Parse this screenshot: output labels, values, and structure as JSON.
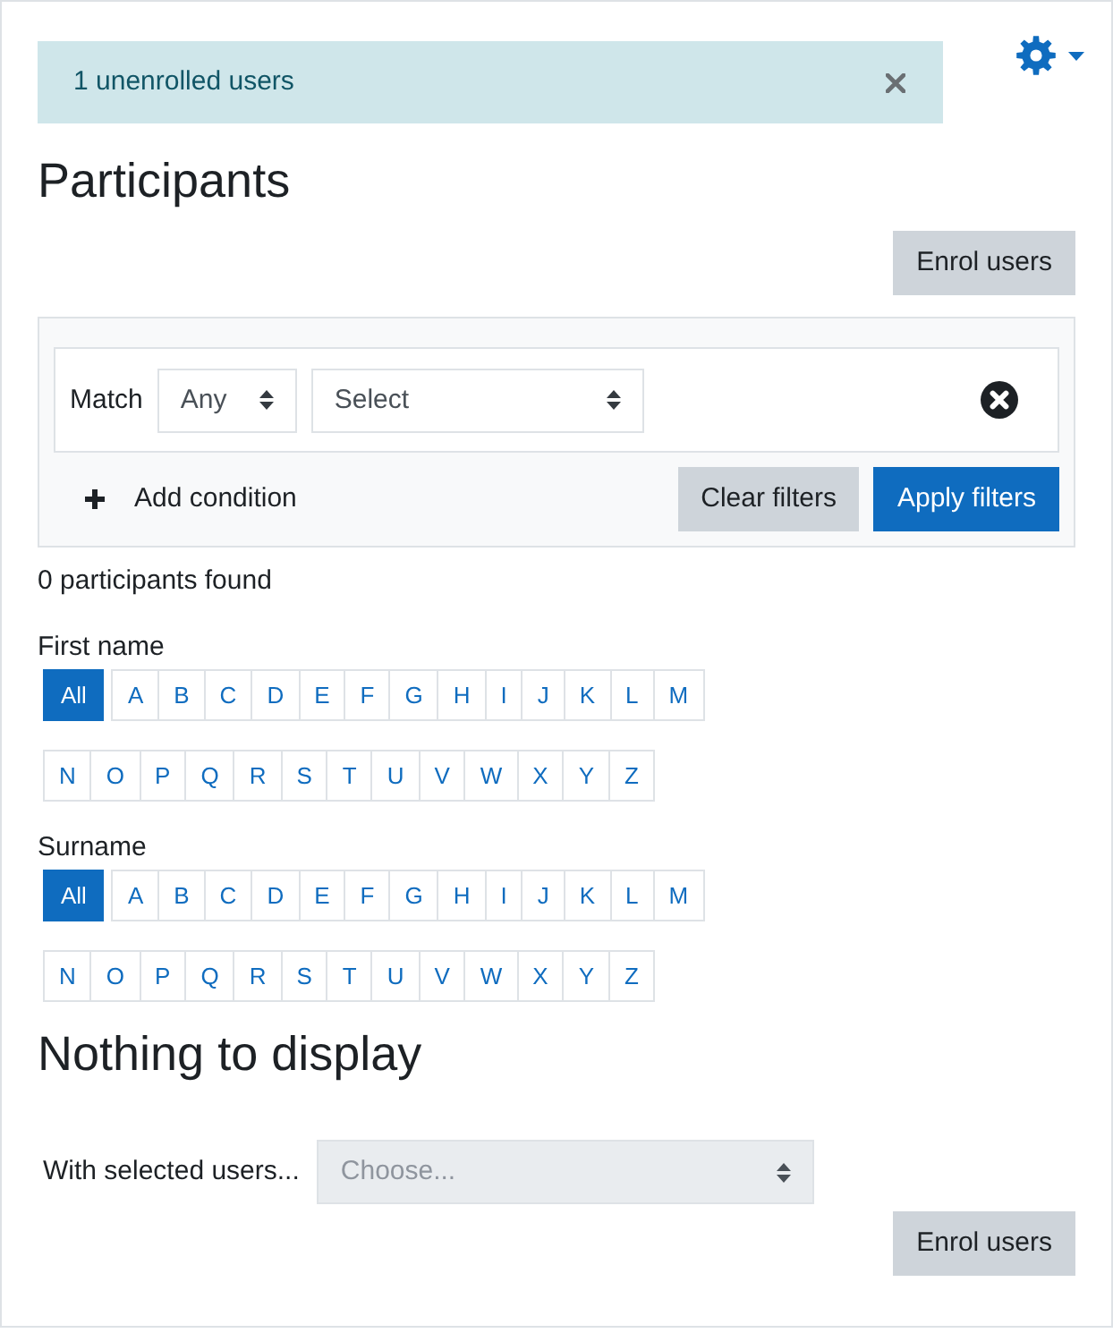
{
  "notification": {
    "message": "1 unenrolled users"
  },
  "page_title": "Participants",
  "enrol_button": "Enrol users",
  "filter": {
    "match_label": "Match",
    "match_select": {
      "value": "Any"
    },
    "type_select": {
      "value": "Select"
    },
    "add_condition": "Add condition",
    "buttons": [
      {
        "label": "Clear filters",
        "kind": "secondary"
      },
      {
        "label": "Apply filters",
        "kind": "primary"
      }
    ]
  },
  "results_count": "0 participants found",
  "initials_bars": [
    {
      "label": "First name",
      "all": {
        "label": "All",
        "selected": true
      },
      "letter_rows": [
        [
          {
            "label": "A",
            "selected": false
          },
          {
            "label": "B",
            "selected": false
          },
          {
            "label": "C",
            "selected": false
          },
          {
            "label": "D",
            "selected": false
          },
          {
            "label": "E",
            "selected": false
          },
          {
            "label": "F",
            "selected": false
          },
          {
            "label": "G",
            "selected": false
          },
          {
            "label": "H",
            "selected": false
          },
          {
            "label": "I",
            "selected": false
          },
          {
            "label": "J",
            "selected": false
          },
          {
            "label": "K",
            "selected": false
          },
          {
            "label": "L",
            "selected": false
          },
          {
            "label": "M",
            "selected": false
          }
        ],
        [
          {
            "label": "N",
            "selected": false
          },
          {
            "label": "O",
            "selected": false
          },
          {
            "label": "P",
            "selected": false
          },
          {
            "label": "Q",
            "selected": false
          },
          {
            "label": "R",
            "selected": false
          },
          {
            "label": "S",
            "selected": false
          },
          {
            "label": "T",
            "selected": false
          },
          {
            "label": "U",
            "selected": false
          },
          {
            "label": "V",
            "selected": false
          },
          {
            "label": "W",
            "selected": false
          },
          {
            "label": "X",
            "selected": false
          },
          {
            "label": "Y",
            "selected": false
          },
          {
            "label": "Z",
            "selected": false
          }
        ]
      ]
    },
    {
      "label": "Surname",
      "all": {
        "label": "All",
        "selected": true
      },
      "letter_rows": [
        [
          {
            "label": "A",
            "selected": false
          },
          {
            "label": "B",
            "selected": false
          },
          {
            "label": "C",
            "selected": false
          },
          {
            "label": "D",
            "selected": false
          },
          {
            "label": "E",
            "selected": false
          },
          {
            "label": "F",
            "selected": false
          },
          {
            "label": "G",
            "selected": false
          },
          {
            "label": "H",
            "selected": false
          },
          {
            "label": "I",
            "selected": false
          },
          {
            "label": "J",
            "selected": false
          },
          {
            "label": "K",
            "selected": false
          },
          {
            "label": "L",
            "selected": false
          },
          {
            "label": "M",
            "selected": false
          }
        ],
        [
          {
            "label": "N",
            "selected": false
          },
          {
            "label": "O",
            "selected": false
          },
          {
            "label": "P",
            "selected": false
          },
          {
            "label": "Q",
            "selected": false
          },
          {
            "label": "R",
            "selected": false
          },
          {
            "label": "S",
            "selected": false
          },
          {
            "label": "T",
            "selected": false
          },
          {
            "label": "U",
            "selected": false
          },
          {
            "label": "V",
            "selected": false
          },
          {
            "label": "W",
            "selected": false
          },
          {
            "label": "X",
            "selected": false
          },
          {
            "label": "Y",
            "selected": false
          },
          {
            "label": "Z",
            "selected": false
          }
        ]
      ]
    }
  ],
  "empty_message": "Nothing to display",
  "bulk_actions": {
    "label": "With selected users...",
    "select": {
      "placeholder": "Choose...",
      "disabled": true
    }
  },
  "footer_button": "Enrol users"
}
